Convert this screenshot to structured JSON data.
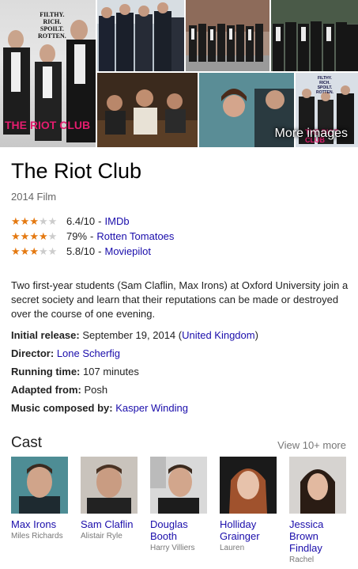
{
  "images": {
    "more_label": "More images",
    "poster_tagline": "FILTHY.\nRICH.\nSPOILT.\nROTTEN.",
    "poster_title": "THE RIOT CLUB",
    "small_poster_tagline": "FILTHY.\nRICH.\nSPOILT.\nROTTEN.",
    "small_poster_title": "THE RIOT CLUB"
  },
  "title": "The Riot Club",
  "subtitle": "2014 Film",
  "ratings": [
    {
      "stars": 3,
      "value": "6.4/10",
      "source": "IMDb"
    },
    {
      "stars": 4,
      "value": "79%",
      "source": "Rotten Tomatoes"
    },
    {
      "stars": 3,
      "value": "5.8/10",
      "source": "Moviepilot"
    }
  ],
  "description": "Two first-year students (Sam Claflin, Max Irons) at Oxford University join a secret society and learn that their reputations can be made or destroyed over the course of one evening.",
  "facts": {
    "release_label": "Initial release:",
    "release_value": "September 19, 2014 (",
    "release_country": "United Kingdom",
    "release_close": ")",
    "director_label": "Director:",
    "director_value": "Lone Scherfig",
    "runtime_label": "Running time:",
    "runtime_value": "107 minutes",
    "adapted_label": "Adapted from:",
    "adapted_value": "Posh",
    "music_label": "Music composed by:",
    "music_value": "Kasper Winding"
  },
  "cast": {
    "heading": "Cast",
    "more": "View 10+ more",
    "members": [
      {
        "name": "Max Irons",
        "role": "Miles Richards"
      },
      {
        "name": "Sam Claflin",
        "role": "Alistair Ryle"
      },
      {
        "name": "Douglas Booth",
        "role": "Harry Villiers"
      },
      {
        "name": "Holliday Grainger",
        "role": "Lauren"
      },
      {
        "name": "Jessica Brown Findlay",
        "role": "Rachel"
      }
    ]
  },
  "colors": {
    "link": "#1a0dab",
    "star": "#e47911",
    "poster_title": "#e41c6e"
  }
}
